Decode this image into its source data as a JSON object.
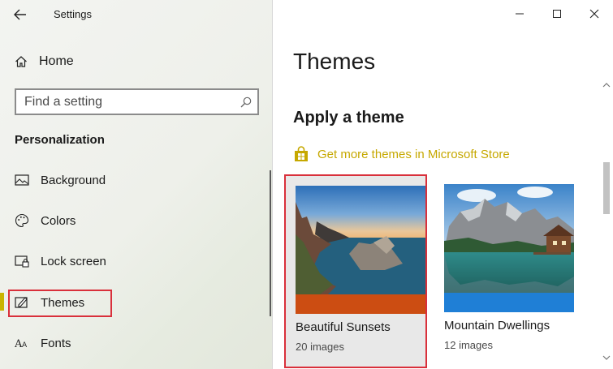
{
  "app": {
    "title": "Settings",
    "window_controls": [
      "minimize",
      "maximize",
      "close"
    ]
  },
  "sidebar": {
    "home_label": "Home",
    "search_placeholder": "Find a setting",
    "section_title": "Personalization",
    "items": [
      {
        "label": "Background",
        "icon": "picture-icon"
      },
      {
        "label": "Colors",
        "icon": "palette-icon"
      },
      {
        "label": "Lock screen",
        "icon": "lock-screen-icon"
      },
      {
        "label": "Themes",
        "icon": "themes-icon",
        "selected": true
      },
      {
        "label": "Fonts",
        "icon": "fonts-icon"
      }
    ]
  },
  "main": {
    "page_title": "Themes",
    "sub_title": "Apply a theme",
    "store_link": "Get more themes in Microsoft Store",
    "themes": [
      {
        "name": "Beautiful Sunsets",
        "count": "20 images",
        "accent": "#cc4d12",
        "selected": true
      },
      {
        "name": "Mountain Dwellings",
        "count": "12 images",
        "accent": "#1f7fd6",
        "selected": false
      }
    ]
  },
  "colors": {
    "highlight_border": "#d9303b",
    "nav_indicator": "#c9b400",
    "store_link": "#c6a800"
  }
}
